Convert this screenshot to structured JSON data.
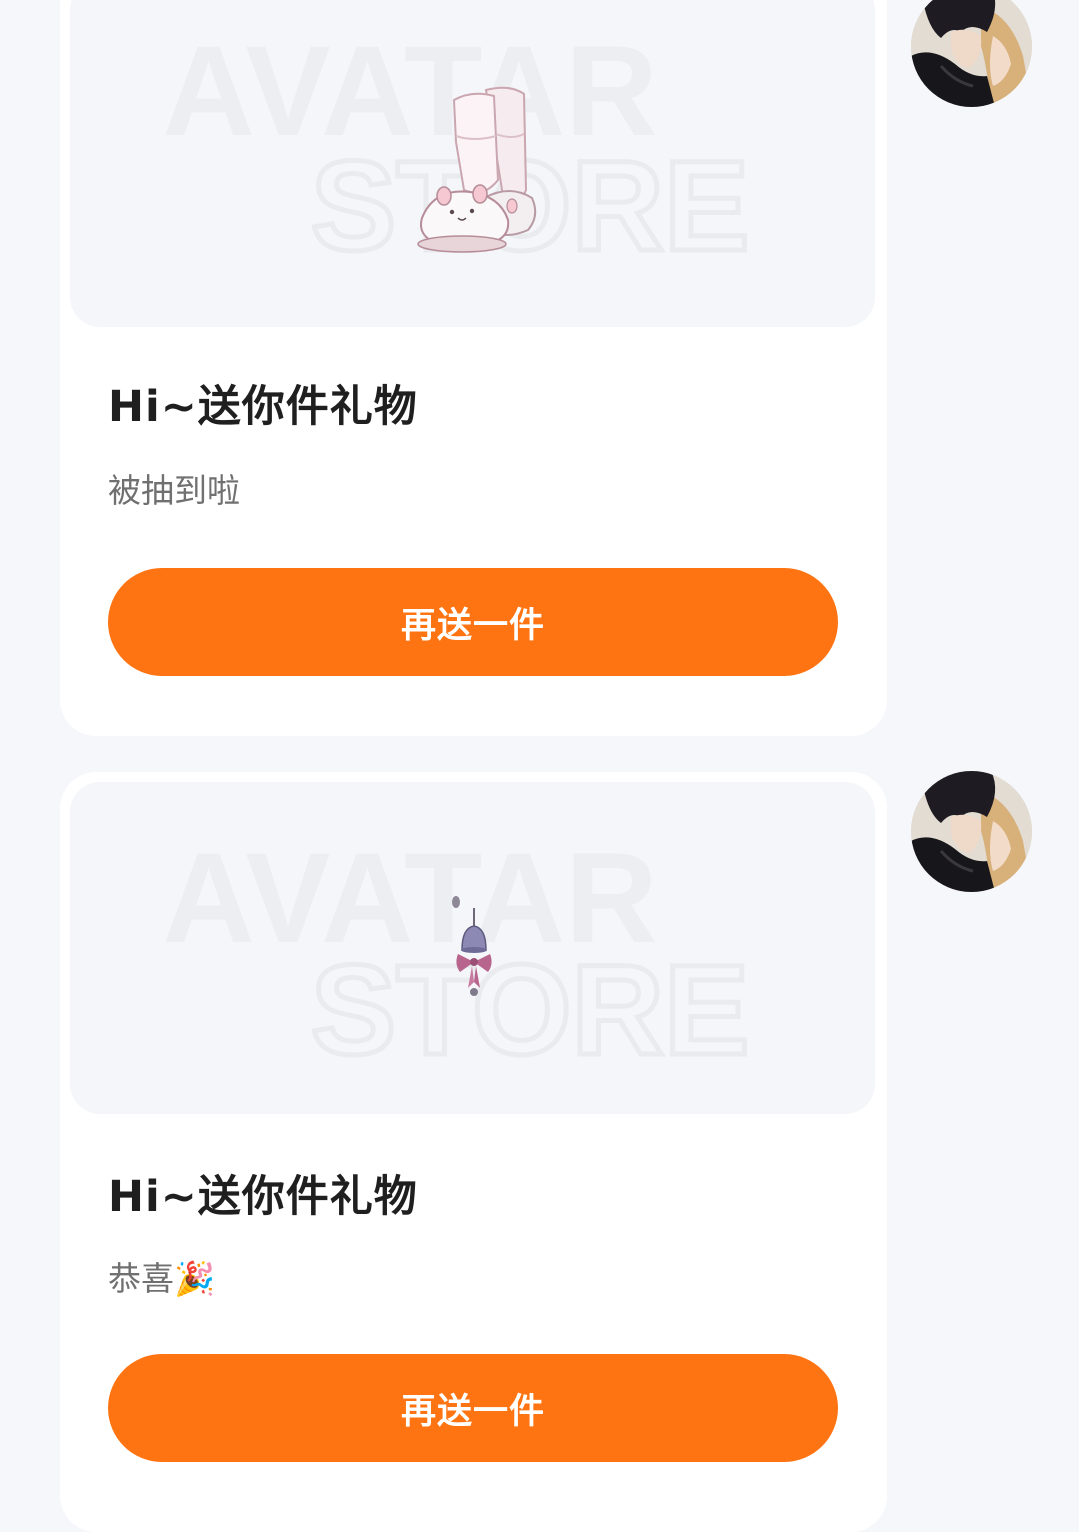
{
  "messages": [
    {
      "watermark_line1": "AVATAR",
      "watermark_line2": "STORE",
      "item_icon": "slippers-with-socks-icon",
      "title": "Hi~送你件礼物",
      "subtitle": "被抽到啦",
      "button_label": "再送一件"
    },
    {
      "watermark_line1": "AVATAR",
      "watermark_line2": "STORE",
      "item_icon": "bell-with-bow-icon",
      "title": "Hi~送你件礼物",
      "subtitle": "恭喜🎉",
      "button_label": "再送一件"
    }
  ],
  "colors": {
    "page_background": "#f5f7fa",
    "card_background": "#ffffff",
    "preview_background": "#f4f6f9",
    "button_background": "#ff7412",
    "button_text": "#ffffff",
    "title_text": "#1f1f1f",
    "subtitle_text": "#707070"
  }
}
